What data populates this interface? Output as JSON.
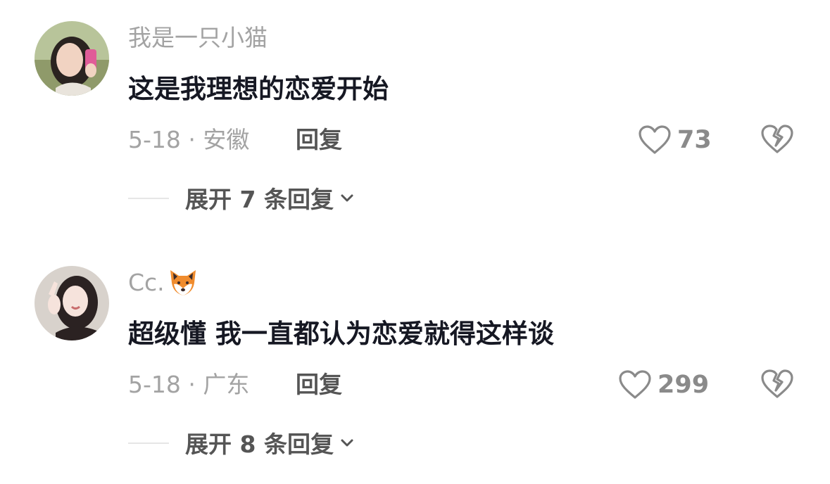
{
  "comments": [
    {
      "username": "我是一只小猫",
      "text": "这是我理想的恋爱开始",
      "meta": "5-18 · 安徽",
      "reply_label": "回复",
      "likes": "73",
      "expand_label": "展开 7 条回复"
    },
    {
      "username": "Cc.",
      "username_emoji": "fox-face-icon",
      "text": "超级懂 我一直都认为恋爱就得这样谈",
      "meta": "5-18 · 广东",
      "reply_label": "回复",
      "likes": "299",
      "expand_label": "展开 8 条回复"
    }
  ],
  "colors": {
    "text_primary": "#161823",
    "text_secondary": "#a3a3a3",
    "icon_gray": "#8a8a8a"
  }
}
